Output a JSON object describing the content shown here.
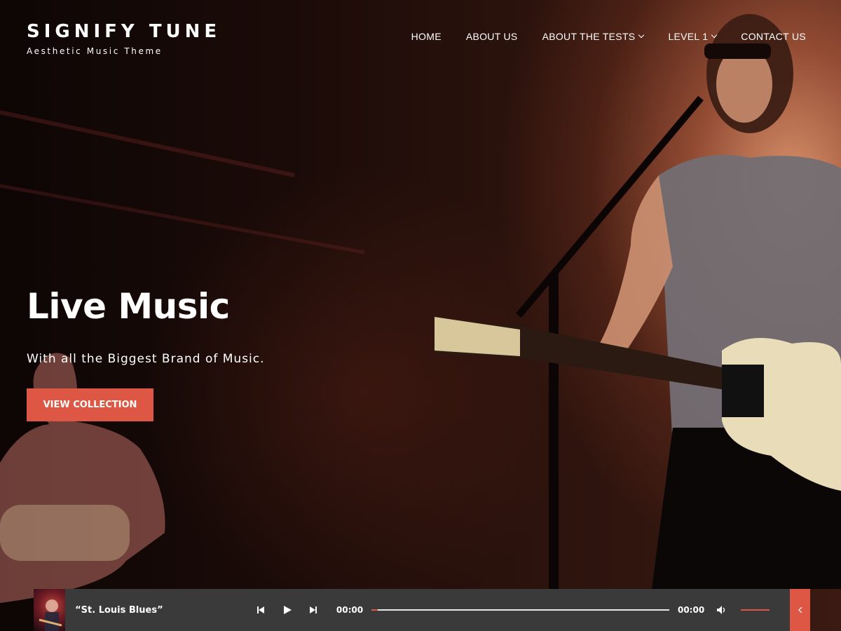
{
  "header": {
    "site_title": "SIGNIFY TUNE",
    "tagline": "Aesthetic Music Theme"
  },
  "nav": {
    "items": [
      {
        "label": "HOME",
        "has_dropdown": false
      },
      {
        "label": "ABOUT US",
        "has_dropdown": false
      },
      {
        "label": "ABOUT THE TESTS",
        "has_dropdown": true
      },
      {
        "label": "LEVEL 1",
        "has_dropdown": true
      },
      {
        "label": "CONTACT US",
        "has_dropdown": false
      }
    ]
  },
  "hero": {
    "title": "Live Music",
    "subtitle": "With all the Biggest Brand of Music.",
    "cta_label": "VIEW COLLECTION"
  },
  "player": {
    "track_title": "“St. Louis Blues”",
    "current_time": "00:00",
    "duration": "00:00",
    "progress_fraction": 0.02,
    "volume_fraction": 1.0
  },
  "colors": {
    "accent": "#de5644",
    "player_bg": "#3a3a3a"
  },
  "icons": {
    "prev": "skip-back-icon",
    "play": "play-icon",
    "next": "skip-forward-icon",
    "volume": "volume-icon",
    "playlist": "playlist-icon",
    "toggle": "chevron-left-icon"
  }
}
